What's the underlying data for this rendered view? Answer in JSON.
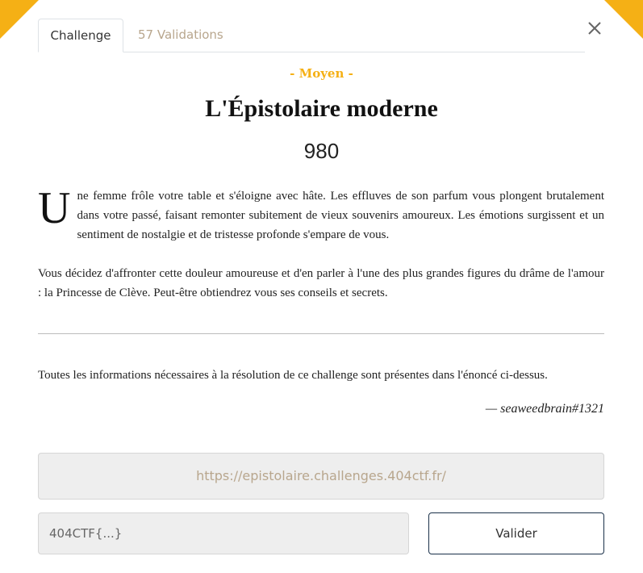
{
  "tabs": [
    {
      "label": "Challenge",
      "active": true
    },
    {
      "label": "57 Validations",
      "active": false
    }
  ],
  "close_icon": "close-icon",
  "challenge": {
    "difficulty": "- Moyen -",
    "title": "L'Épistolaire moderne",
    "points": "980",
    "description_dropcap": "U",
    "description_p1": "ne femme frôle votre table et s'éloigne avec hâte. Les effluves de son parfum vous plongent brutalement dans votre passé, faisant remonter subitement de vieux souvenirs amoureux. Les émotions surgissent et un sentiment de nostalgie et de tristesse profonde s'empare de vous.",
    "description_p2": "Vous décidez d'affronter cette douleur amoureuse et d'en parler à l'une des plus grandes figures du drâme de l'amour : la Princesse de Clève. Peut-être obtiendrez vous ses conseils et secrets.",
    "info": "Toutes les informations nécessaires à la résolution de ce challenge sont présentes dans l'énoncé ci-dessus.",
    "author": "— seaweedbrain#1321",
    "url": "https://epistolaire.challenges.404ctf.fr/"
  },
  "form": {
    "flag_placeholder": "404CTF{...}",
    "flag_value": "",
    "submit_label": "Valider"
  },
  "colors": {
    "accent": "#f5b015",
    "link": "#b8a68d",
    "button_border": "#1a3049"
  }
}
